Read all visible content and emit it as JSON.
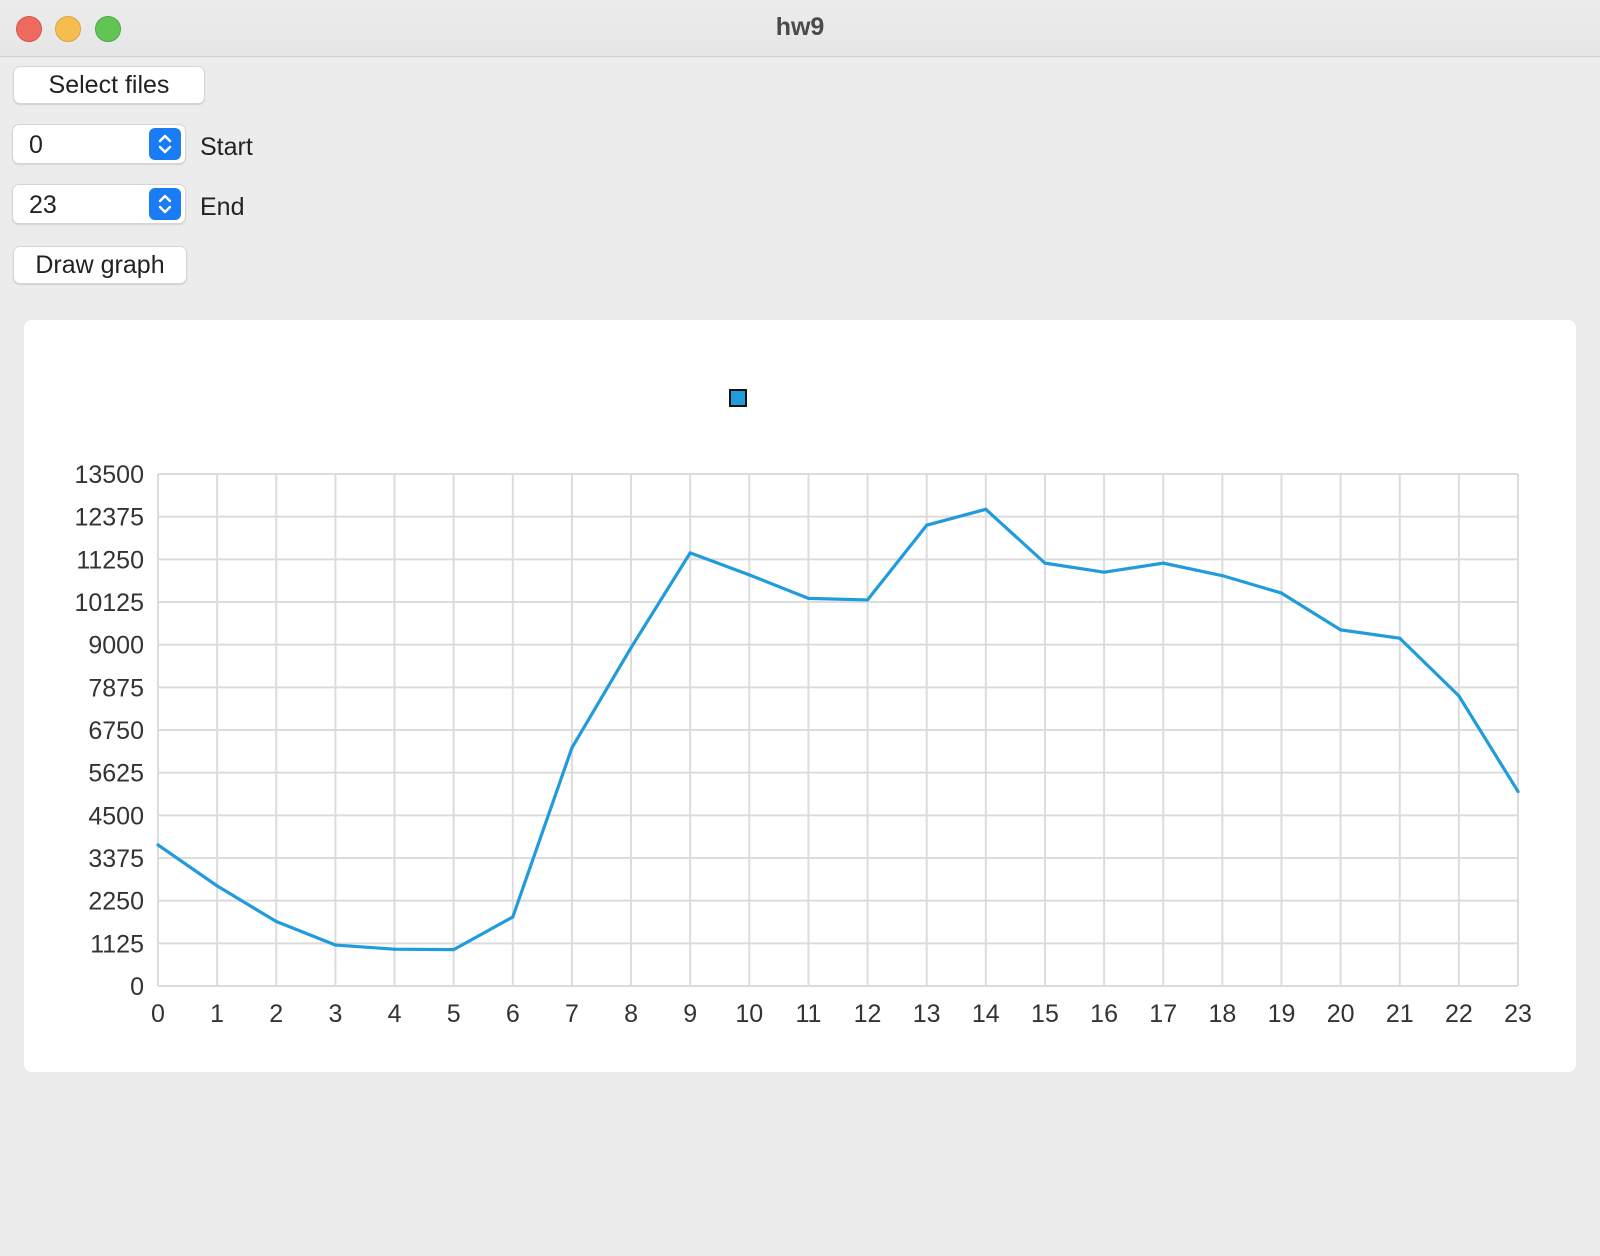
{
  "window": {
    "title": "hw9"
  },
  "controls": {
    "select_files_label": "Select files",
    "start": {
      "value": "0",
      "label": "Start"
    },
    "end": {
      "value": "23",
      "label": "End"
    },
    "draw_graph_label": "Draw graph"
  },
  "colors": {
    "series": "#209bdc",
    "grid": "#dcdcdc",
    "accent": "#1a7cf5"
  },
  "chart_data": {
    "type": "line",
    "title": "",
    "xlabel": "",
    "ylabel": "",
    "legend": {
      "placement": "top-center",
      "entries": [
        ""
      ]
    },
    "grid": true,
    "xlim": [
      0,
      23
    ],
    "ylim": [
      0,
      13500
    ],
    "x_ticks": [
      "0",
      "1",
      "2",
      "3",
      "4",
      "5",
      "6",
      "7",
      "8",
      "9",
      "10",
      "11",
      "12",
      "13",
      "14",
      "15",
      "16",
      "17",
      "18",
      "19",
      "20",
      "21",
      "22",
      "23"
    ],
    "y_ticks": [
      "0",
      "1125",
      "2250",
      "3375",
      "4500",
      "5625",
      "6750",
      "7875",
      "9000",
      "10125",
      "11250",
      "12375",
      "13500"
    ],
    "x": [
      0,
      1,
      2,
      3,
      4,
      5,
      6,
      7,
      8,
      9,
      10,
      11,
      12,
      13,
      14,
      15,
      16,
      17,
      18,
      19,
      20,
      21,
      22,
      23
    ],
    "series": [
      {
        "values": [
          3720,
          2640,
          1700,
          1080,
          970,
          960,
          1820,
          6280,
          8920,
          11420,
          10840,
          10220,
          10180,
          12150,
          12570,
          11150,
          10910,
          11150,
          10820,
          10360,
          9390,
          9170,
          7650,
          5130
        ]
      }
    ]
  }
}
